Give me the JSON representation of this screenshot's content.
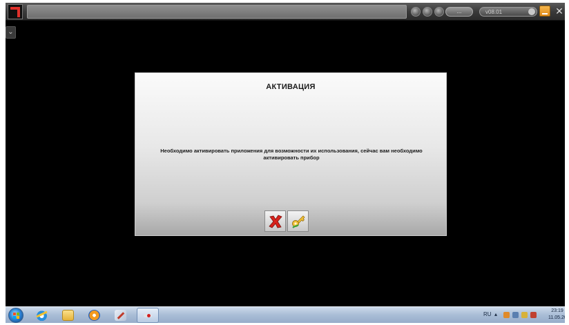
{
  "topbar": {
    "version_label": "v08.01",
    "status_label": "...",
    "close_glyph": "✕"
  },
  "side_toggle_glyph": "⌄",
  "dialog": {
    "title": "АКТИВАЦИЯ",
    "message": "Необходимо активировать приложения для возможности их использования, сейчас вам необходимо активировать прибор",
    "cancel_icon": "close-x-icon",
    "activate_icon": "key-icon"
  },
  "taskbar": {
    "pinned_icons": [
      "start-orb-icon",
      "internet-explorer-icon",
      "file-explorer-icon",
      "media-player-icon",
      "paint-icon",
      "app-icon"
    ],
    "tray": {
      "language": "RU",
      "time": "23:19",
      "date": "11.05.2020"
    }
  },
  "colors": {
    "dialog_accent_red": "#d8231c",
    "taskbar": "#a9bdd6",
    "logo_red": "#e0312b"
  }
}
